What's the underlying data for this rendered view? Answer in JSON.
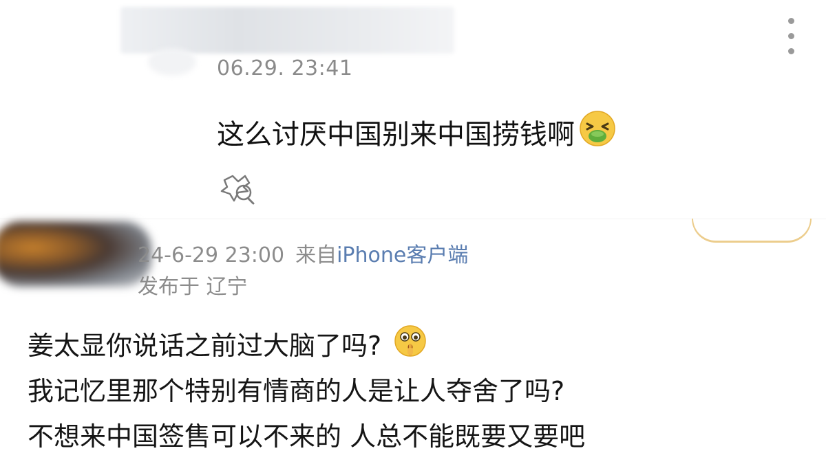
{
  "top_comment": {
    "timestamp": "06.29. 23:41",
    "text": "这么讨厌中国别来中国捞钱啊",
    "emoji": "nauseated-face",
    "icons": {
      "more": "more-vertical-icon",
      "reply": "reply-bubble-icon"
    }
  },
  "post": {
    "time": "24-6-29 23:00",
    "from_label": "来自",
    "client": "iPhone客户端",
    "location": "发布于 辽宁",
    "lines": [
      "姜太显你说话之前过大脑了吗?",
      "我记忆里那个特别有情商的人是让人夺舍了吗?",
      "不想来中国签售可以不来的 人总不能既要又要吧"
    ],
    "emoji": "shushing-face"
  },
  "colors": {
    "timestamp": "#8a8a8a",
    "meta": "#8c8c8c",
    "client_link": "#5a7db0",
    "text": "#111111"
  }
}
